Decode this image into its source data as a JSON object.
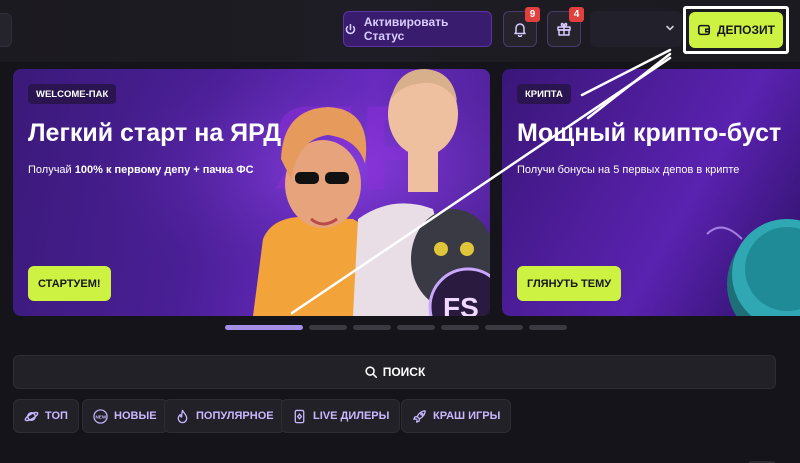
{
  "header": {
    "status_label": "Активировать Статус",
    "notifications_count": "9",
    "gifts_count": "4",
    "deposit_label": "ДЕПОЗИТ"
  },
  "banners": [
    {
      "tag": "WELCOME-ПАК",
      "title": "Легкий старт на ЯРД",
      "subtitle_pre": "Получай ",
      "subtitle_bold": "100% к первому депу + пачка ФС",
      "button": "СТАРТУЕМ!"
    },
    {
      "tag": "КРИПТА",
      "title": "Мощный крипто-буст",
      "subtitle": "Получи бонусы на 5 первых депов в крипте",
      "button": "ГЛЯНУТЬ ТЕМУ"
    }
  ],
  "carousel": {
    "total": 7,
    "active": 1
  },
  "search": {
    "label": "ПОИСК"
  },
  "categories": [
    {
      "label": "ТОП",
      "icon": "planet-icon"
    },
    {
      "label": "НОВЫЕ",
      "icon": "new-badge-icon"
    },
    {
      "label": "ПОПУЛЯРНОЕ",
      "icon": "flame-icon"
    },
    {
      "label": "LIVE ДИЛЕРЫ",
      "icon": "card-icon"
    },
    {
      "label": "КРАШ ИГРЫ",
      "icon": "rocket-icon"
    }
  ],
  "colors": {
    "accent": "#cdf241",
    "purple": "#5a22b0",
    "badge": "#e2403f",
    "background": "#15141a"
  }
}
